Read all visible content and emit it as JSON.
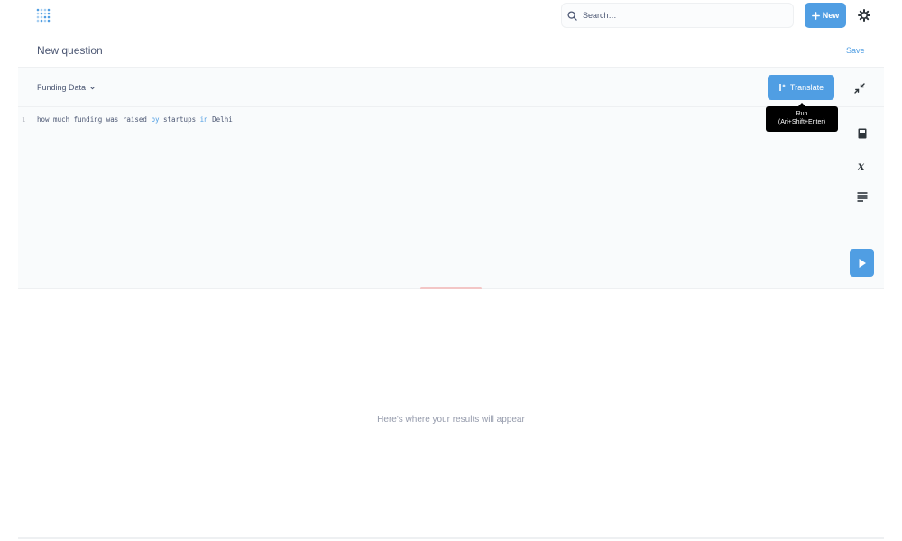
{
  "topbar": {
    "search": {
      "placeholder": "Search…"
    },
    "new_label": "New"
  },
  "header": {
    "title": "New question",
    "save_label": "Save"
  },
  "editor": {
    "database": "Funding Data",
    "translate_label": "Translate",
    "line_number": "1",
    "query": {
      "part1": "how much funding was raised ",
      "keyword1": "by",
      "part2": " startups ",
      "keyword2": "in",
      "part3": " Delhi"
    },
    "tooltip": {
      "line1": "Run",
      "line2": "(Ari+Shift+Enter)"
    }
  },
  "results": {
    "empty_message": "Here's where your results will appear"
  },
  "colors": {
    "brand": "#509ee3",
    "text": "#4c5773",
    "muted": "#949aab"
  }
}
